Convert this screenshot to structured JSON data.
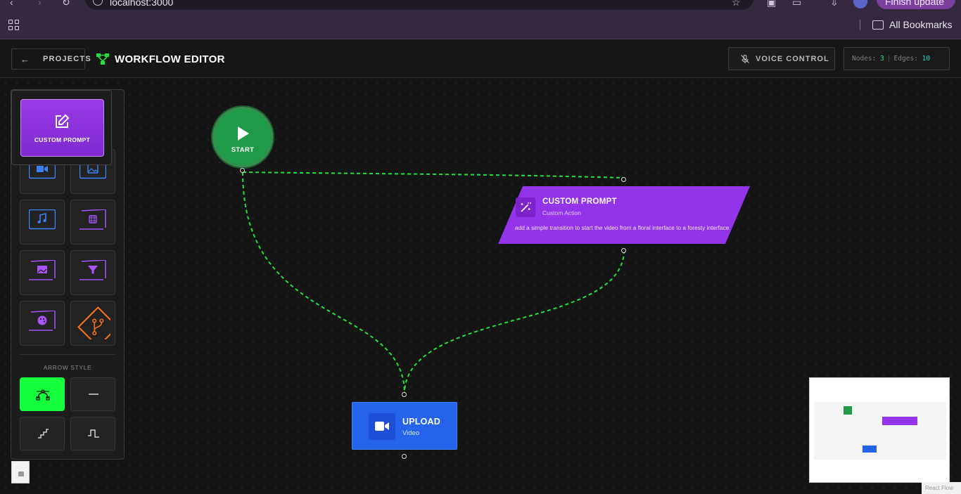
{
  "browser": {
    "url": "localhost:3000",
    "update_button": "Finish update",
    "bookmarks_label": "All Bookmarks"
  },
  "header": {
    "back_label": "PROJECTS",
    "title": "WORKFLOW EDITOR",
    "voice_label": "VOICE CONTROL",
    "stats": {
      "nodes_label": "Nodes:",
      "nodes": "3",
      "edges_label": "Edges:",
      "edges": "10"
    }
  },
  "palette": {
    "popup_label": "CUSTOM PROMPT",
    "items": [
      {
        "name": "video-upload",
        "icon": "video-icon",
        "color": "#3b82f6"
      },
      {
        "name": "image-upload",
        "icon": "image-icon",
        "color": "#3b82f6"
      },
      {
        "name": "audio-upload",
        "icon": "music-icon",
        "color": "#3b82f6"
      },
      {
        "name": "video-process",
        "icon": "film-icon",
        "color": "#a855f7"
      },
      {
        "name": "image-process",
        "icon": "image-icon",
        "color": "#a855f7"
      },
      {
        "name": "filter",
        "icon": "filter-icon",
        "color": "#a855f7"
      },
      {
        "name": "style",
        "icon": "palette-icon",
        "color": "#a855f7"
      },
      {
        "name": "branch",
        "icon": "git-branch-icon",
        "color": "#f97316"
      }
    ],
    "arrow_style_label": "ARROW STYLE",
    "arrow_styles": [
      {
        "name": "bezier",
        "icon": "bezier-curve-icon",
        "active": true
      },
      {
        "name": "straight",
        "icon": "straight-line-icon",
        "active": false
      },
      {
        "name": "step",
        "icon": "step-line-icon",
        "active": false
      },
      {
        "name": "smoothstep",
        "icon": "smoothstep-line-icon",
        "active": false
      }
    ]
  },
  "nodes": {
    "start": {
      "label": "START",
      "color": "#1f9a47"
    },
    "custom_prompt": {
      "title": "CUSTOM PROMPT",
      "subtitle": "Custom Action",
      "description": "add a simple transition to start the video from a floral interface to a foresty interface",
      "color": "#9333ea"
    },
    "upload": {
      "title": "UPLOAD",
      "subtitle": "Video",
      "color": "#2563eb"
    }
  },
  "edges": [
    {
      "from": "start",
      "to": "custom_prompt"
    },
    {
      "from": "start",
      "to": "upload"
    },
    {
      "from": "custom_prompt",
      "to": "upload"
    }
  ],
  "edge_color": "#22e03c",
  "minimap": {
    "nodes": [
      {
        "id": "start",
        "color": "#1f9a47"
      },
      {
        "id": "custom_prompt",
        "color": "#9333ea"
      },
      {
        "id": "upload",
        "color": "#2563eb"
      }
    ]
  },
  "attribution": "React Flow"
}
